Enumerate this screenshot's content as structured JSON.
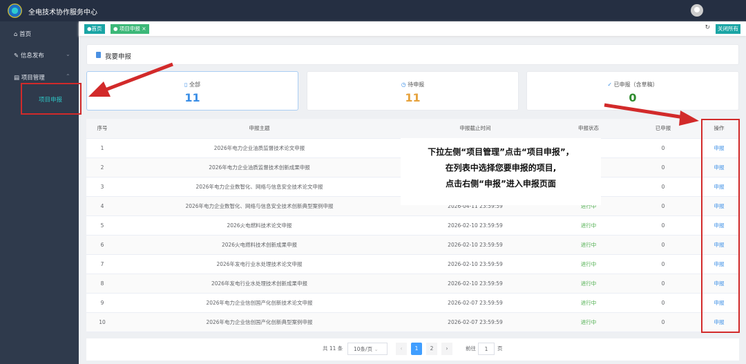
{
  "app": {
    "title": "全电技术协作服务中心"
  },
  "sidebar": {
    "items": [
      {
        "label": "首页"
      },
      {
        "label": "信息发布"
      },
      {
        "label": "项目管理"
      }
    ],
    "sub_item": "项目申报"
  },
  "tags": {
    "home": "●首页",
    "current": "● 项目申报 ×",
    "close_all": "关闭所有"
  },
  "panel": {
    "title": "我要申报"
  },
  "stats": [
    {
      "label": "全部",
      "value": "11",
      "color": "#3a8ee6"
    },
    {
      "label": "待申报",
      "value": "11",
      "color": "#e6a23c"
    },
    {
      "label": "已申报（含草稿）",
      "value": "0",
      "color": "#2e8b2e"
    }
  ],
  "table": {
    "headers": [
      "序号",
      "申报主题",
      "申报截止时间",
      "申报状态",
      "已申报",
      "操作"
    ],
    "rows": [
      {
        "no": "1",
        "title": "2026年电力企业油质监督技术论文申报",
        "deadline": "",
        "status": "",
        "count": "0",
        "action": "申报"
      },
      {
        "no": "2",
        "title": "2026年电力企业油质监督技术创新成果申报",
        "deadline": "",
        "status": "",
        "count": "0",
        "action": "申报"
      },
      {
        "no": "3",
        "title": "2026年电力企业数智化、网络与信息安全技术论文申报",
        "deadline": "",
        "status": "",
        "count": "0",
        "action": "申报"
      },
      {
        "no": "4",
        "title": "2026年电力企业数智化、网络与信息安全技术创新典型案例申报",
        "deadline": "2026-04-11 23:59:59",
        "status": "进行中",
        "count": "0",
        "action": "申报"
      },
      {
        "no": "5",
        "title": "2026火电燃料技术论文申报",
        "deadline": "2026-02-10 23:59:59",
        "status": "进行中",
        "count": "0",
        "action": "申报"
      },
      {
        "no": "6",
        "title": "2026火电燃料技术创新成果申报",
        "deadline": "2026-02-10 23:59:59",
        "status": "进行中",
        "count": "0",
        "action": "申报"
      },
      {
        "no": "7",
        "title": "2026年发电行业水处理技术论文申报",
        "deadline": "2026-02-10 23:59:59",
        "status": "进行中",
        "count": "0",
        "action": "申报"
      },
      {
        "no": "8",
        "title": "2026年发电行业水处理技术创新成果申报",
        "deadline": "2026-02-10 23:59:59",
        "status": "进行中",
        "count": "0",
        "action": "申报"
      },
      {
        "no": "9",
        "title": "2026年电力企业信创国产化创新技术论文申报",
        "deadline": "2026-02-07 23:59:59",
        "status": "进行中",
        "count": "0",
        "action": "申报"
      },
      {
        "no": "10",
        "title": "2026年电力企业信创国产化创新典型案例申报",
        "deadline": "2026-02-07 23:59:59",
        "status": "进行中",
        "count": "0",
        "action": "申报"
      }
    ]
  },
  "pagination": {
    "total": "共 11 条",
    "page_size": "10条/页",
    "pages": [
      "1",
      "2"
    ],
    "goto_label": "前往",
    "goto_value": "1",
    "page_unit": "页"
  },
  "annotation": {
    "lines": [
      "下拉左侧“项目管理”点击“项目申报”，",
      "在列表中选择您要申报的项目,",
      "点击右侧“申报”进入申报页面"
    ]
  }
}
